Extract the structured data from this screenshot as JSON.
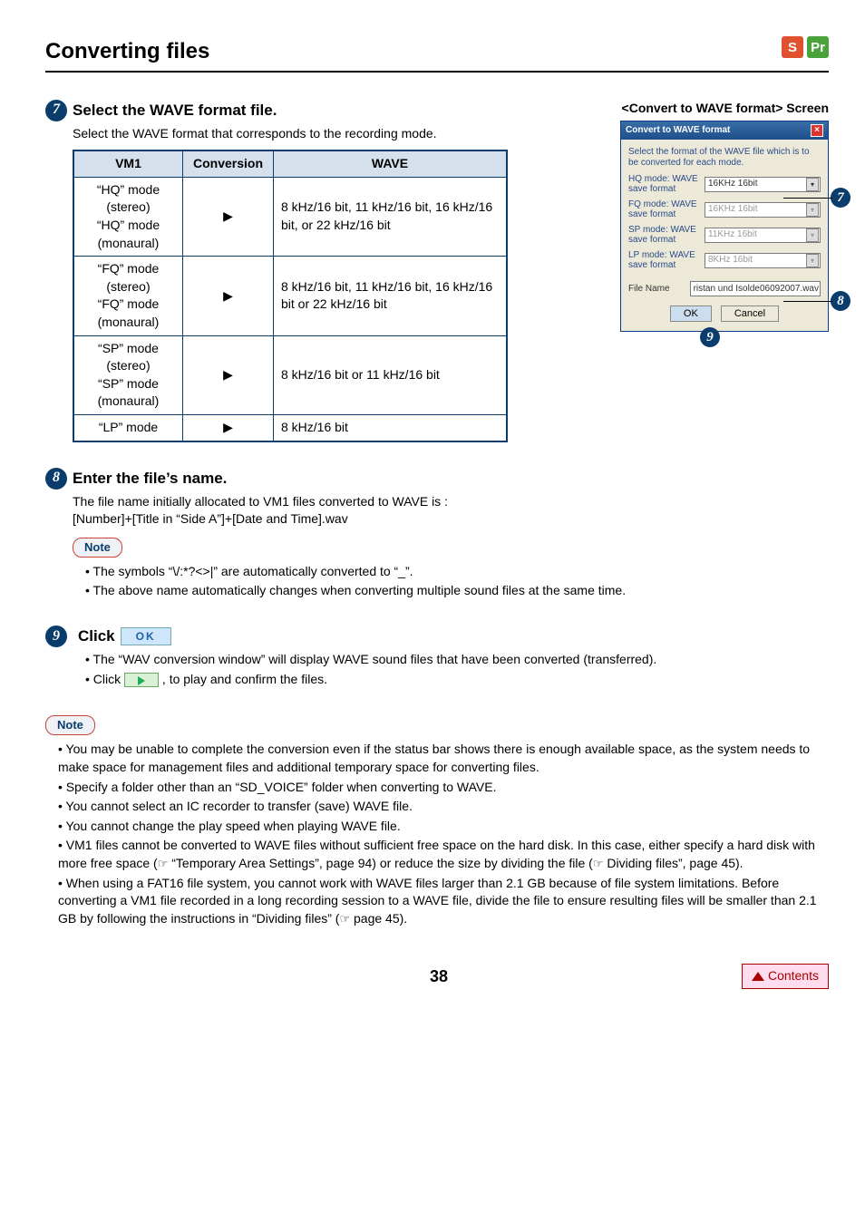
{
  "header": {
    "title": "Converting files",
    "badge_s": "S",
    "badge_p": "Pr"
  },
  "step7": {
    "num": "7",
    "title": "Select the WAVE format file.",
    "desc": "Select the WAVE format that corresponds to the recording mode.",
    "th_vm1": "VM1",
    "th_conv": "Conversion",
    "th_wave": "WAVE",
    "r1_vm1": "“HQ” mode (stereo)\n“HQ” mode (monaural)",
    "r1_wave": "8 kHz/16 bit, 11 kHz/16 bit, 16 kHz/16 bit, or 22 kHz/16 bit",
    "r2_vm1": "“FQ” mode (stereo)\n“FQ” mode (monaural)",
    "r2_wave": "8 kHz/16 bit, 11 kHz/16 bit, 16 kHz/16 bit or 22 kHz/16 bit",
    "r3_vm1": "“SP” mode (stereo)\n“SP” mode (monaural)",
    "r3_wave": "8 kHz/16 bit or 11 kHz/16 bit",
    "r4_vm1": "“LP” mode",
    "r4_wave": "8 kHz/16 bit",
    "arrow": "▶"
  },
  "screen": {
    "title": "<Convert to WAVE format> Screen",
    "dlg_title": "Convert to WAVE format",
    "dlg_desc": "Select the format of the WAVE file which is to be converted for each mode.",
    "hq_lbl": "HQ mode: WAVE save format",
    "hq_val": "16KHz 16bit",
    "fq_lbl": "FQ mode: WAVE save format",
    "fq_val": "16KHz 16bit",
    "sp_lbl": "SP mode: WAVE save format",
    "sp_val": "11KHz 16bit",
    "lp_lbl": "LP mode: WAVE save format",
    "lp_val": "8KHz 16bit",
    "fn_lbl": "File Name",
    "fn_val": "ristan und Isolde06092007.wav",
    "ok": "OK",
    "cancel": "Cancel",
    "m7": "7",
    "m8": "8",
    "m9": "9"
  },
  "step8": {
    "num": "8",
    "title": "Enter the file’s name.",
    "l1": "The file name initially allocated to VM1 files converted to WAVE is :",
    "l2": "[Number]+[Title in “Side A”]+[Date and Time].wav",
    "note": "Note",
    "b1": "The symbols “\\/:*?<>|” are automatically converted to “_”.",
    "b2": "The above name automatically changes when converting multiple sound files at the same time."
  },
  "step9": {
    "num": "9",
    "title_prefix": "Click",
    "ok_label": "OK",
    "b1a": "The “WAV conversion window” will display WAVE sound files that have been converted (transferred).",
    "b2a": "Click ",
    "b2b": ", to play and confirm the files."
  },
  "note2": {
    "label": "Note",
    "i1": "You may be unable to complete the conversion even if the status bar shows there is enough available space, as the system needs to make space for management files and additional temporary space for converting files.",
    "i2": "Specify a folder other than an “SD_VOICE” folder when converting to WAVE.",
    "i3": "You cannot select an IC recorder to transfer (save) WAVE file.",
    "i4": "You cannot change the play speed when playing WAVE file.",
    "i5a": "VM1 files cannot be converted to WAVE files without sufficient free space on the hard disk. In this case, either specify a hard disk with more free space (",
    "i5b": " “Temporary Area Settings”, page 94) or reduce the size by dividing the file (",
    "i5c": " Dividing files”, page 45).",
    "i6a": "When using a FAT16 file system, you cannot work with WAVE files larger than 2.1 GB because of file system limitations. Before converting a VM1 file recorded in a long recording session to a WAVE file, divide the file to ensure resulting files will be smaller than 2.1 GB by following the instructions in “Dividing files” (",
    "i6b": " page 45).",
    "ref": "☞"
  },
  "footer": {
    "page": "38",
    "contents": "Contents"
  }
}
